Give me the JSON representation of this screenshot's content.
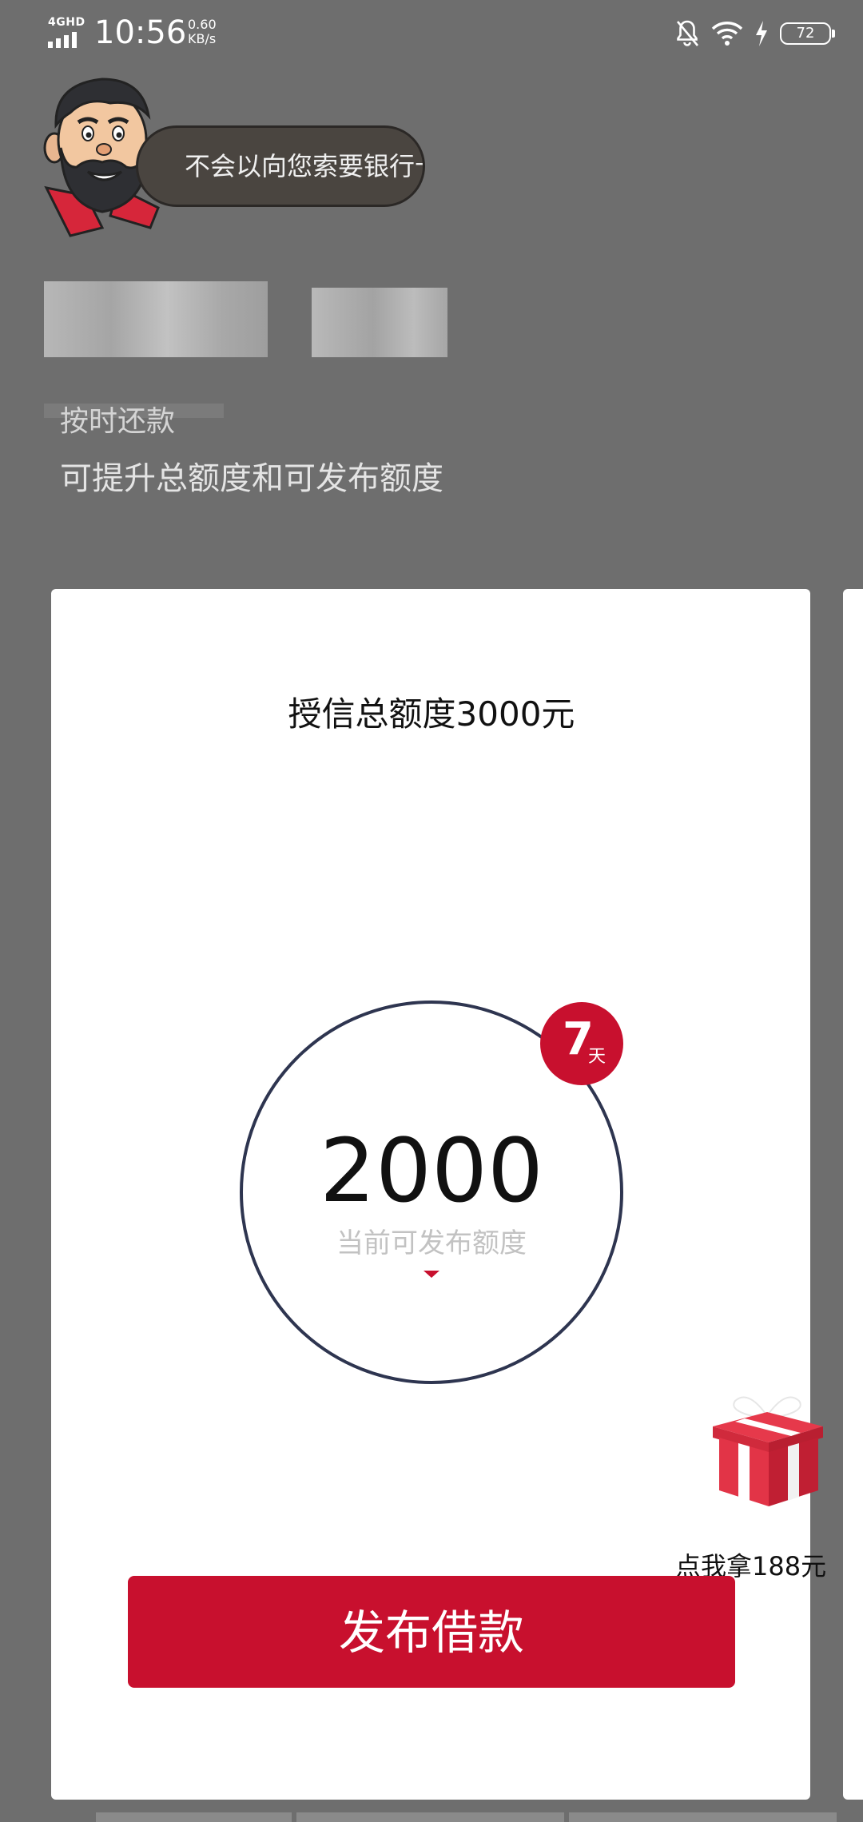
{
  "status_bar": {
    "network_type": "4GHD",
    "time": "10:56",
    "net_speed_value": "0.60",
    "net_speed_unit": "KB/s",
    "battery_level": "72",
    "icons": [
      "notifications-off-icon",
      "wifi-icon",
      "charging-icon",
      "battery-icon"
    ]
  },
  "assistant": {
    "bubble_text": "不会以向您索要银行卡"
  },
  "info": {
    "partial_line": "按时还款",
    "line": "可提升总额度和可发布额度"
  },
  "card": {
    "title": "授信总额度3000元",
    "amount": "2000",
    "amount_label": "当前可发布额度",
    "days_badge_number": "7",
    "days_badge_unit": "天",
    "publish_button": "发布借款"
  },
  "gift": {
    "label": "点我拿188元"
  },
  "colors": {
    "background": "#6e6e6e",
    "accent_red": "#c8102e",
    "circle_border": "#2e3550",
    "bubble_bg": "#4a4540"
  }
}
